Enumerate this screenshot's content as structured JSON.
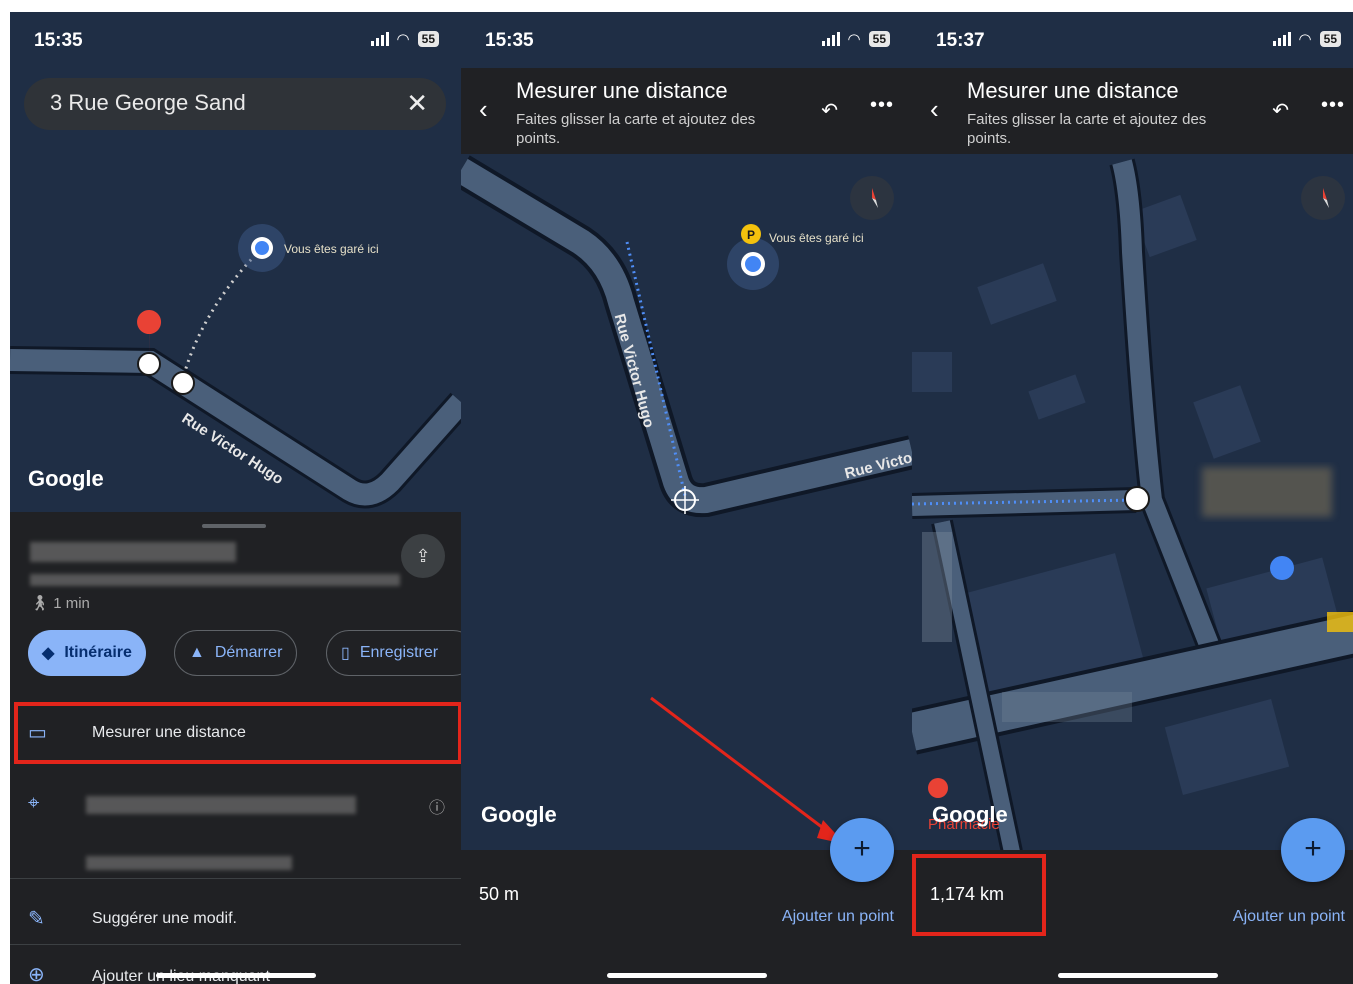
{
  "panel1": {
    "status": {
      "time": "15:35",
      "battery": "55"
    },
    "search": {
      "text": "3 Rue George Sand",
      "clear_icon": "close-icon"
    },
    "map": {
      "parked_label": "Vous êtes garé ici",
      "street": "Rue Victor Hugo",
      "logo": "Google"
    },
    "sheet": {
      "walk_time": "1 min",
      "buttons": {
        "itinerary": "Itinéraire",
        "start": "Démarrer",
        "save": "Enregistrer"
      },
      "rows": {
        "measure": "Mesurer une distance",
        "suggest": "Suggérer une modif.",
        "add_place": "Ajouter un lieu manquant"
      }
    }
  },
  "panel2": {
    "status": {
      "time": "15:35",
      "battery": "55"
    },
    "header": {
      "title": "Mesurer une distance",
      "subtitle": "Faites glisser la carte et ajoutez des points."
    },
    "map": {
      "parked_label": "Vous êtes garé ici",
      "street1": "Rue Victor Hugo",
      "street2": "Rue Victor",
      "logo": "Google"
    },
    "bottom": {
      "distance": "50 m",
      "add_point": "Ajouter un point",
      "fab": "+"
    }
  },
  "panel3": {
    "status": {
      "time": "15:37",
      "battery": "55"
    },
    "header": {
      "title": "Mesurer une distance",
      "subtitle": "Faites glisser la carte et ajoutez des points."
    },
    "map": {
      "logo": "Google",
      "poi": "Pharmacie"
    },
    "bottom": {
      "distance": "1,174 km",
      "add_point": "Ajouter un point",
      "fab": "+"
    }
  },
  "colors": {
    "accent": "#8ab4f8",
    "highlight": "#e3251b",
    "map_bg": "#1f2e45",
    "road": "#4a5f7a"
  }
}
